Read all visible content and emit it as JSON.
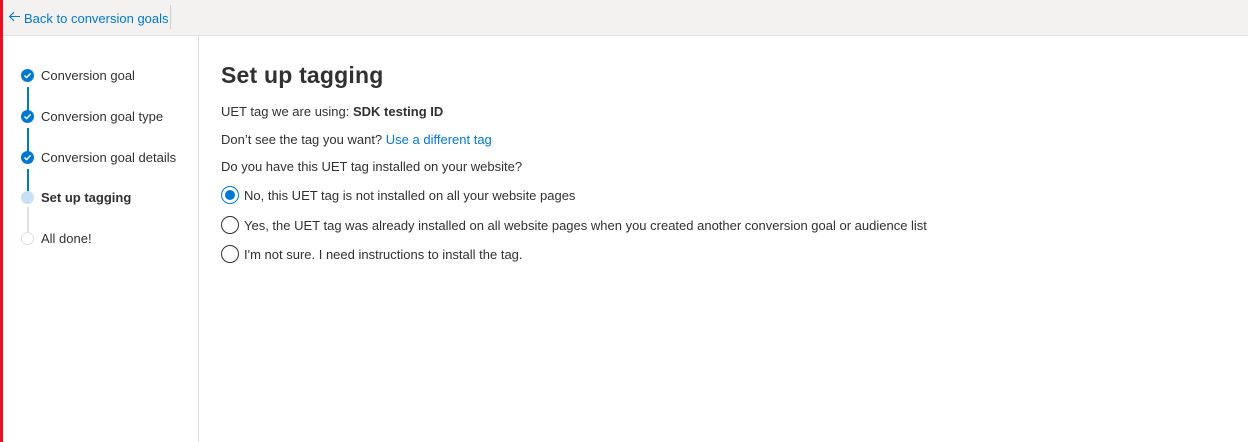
{
  "topbar": {
    "back_label": "Back to conversion goals"
  },
  "steps": [
    {
      "label": "Conversion goal",
      "state": "done"
    },
    {
      "label": "Conversion goal type",
      "state": "done"
    },
    {
      "label": "Conversion goal details",
      "state": "done"
    },
    {
      "label": "Set up tagging",
      "state": "current"
    },
    {
      "label": "All done!",
      "state": "pending"
    }
  ],
  "main": {
    "title": "Set up tagging",
    "uet_prefix": "UET tag we are using: ",
    "uet_name": "SDK testing ID",
    "dont_see_prefix": "Don’t see the tag you want? ",
    "different_tag_link": "Use a different tag",
    "question": "Do you have this UET tag installed on your website?",
    "options": [
      {
        "label": "No, this UET tag is not installed on all your website pages",
        "selected": true
      },
      {
        "label": "Yes, the UET tag was already installed on all website pages when you created another conversion goal or audience list",
        "selected": false
      },
      {
        "label": "I'm not sure. I need instructions to install the tag.",
        "selected": false
      }
    ]
  },
  "colors": {
    "accent": "#0078d4",
    "edge": "#e81123"
  }
}
